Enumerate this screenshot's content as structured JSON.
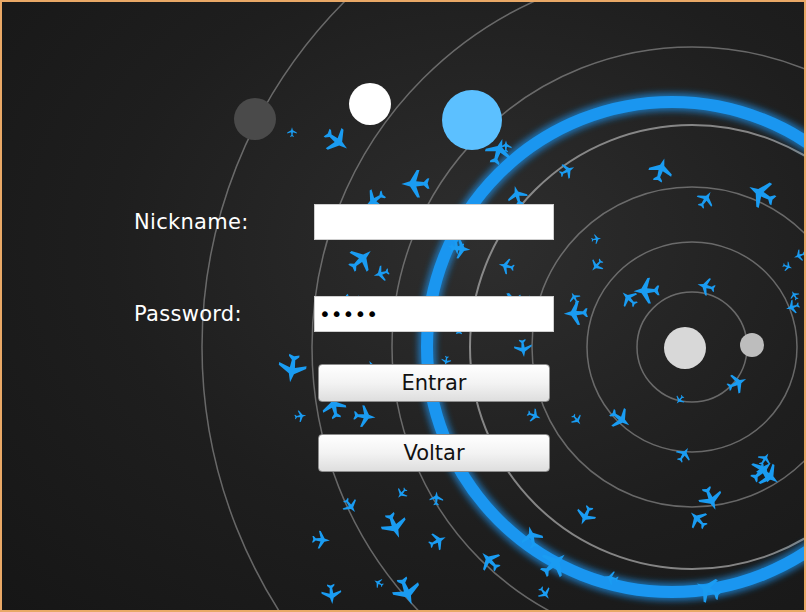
{
  "form": {
    "fields": [
      {
        "label": "Nickname:",
        "value": "",
        "kind": "text"
      },
      {
        "label": "Password:",
        "value": "•••••",
        "kind": "password"
      }
    ],
    "buttons": [
      "Entrar",
      "Voltar"
    ]
  }
}
